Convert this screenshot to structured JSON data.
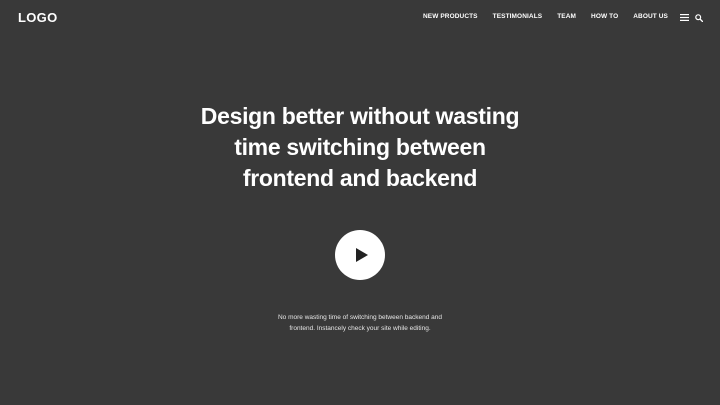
{
  "header": {
    "logo": "LOGO",
    "nav": [
      {
        "label": "NEW PRODUCTS"
      },
      {
        "label": "TESTIMONIALS"
      },
      {
        "label": "TEAM"
      },
      {
        "label": "HOW TO"
      },
      {
        "label": "ABOUT US"
      }
    ],
    "icons": {
      "menu": "hamburger-menu-icon",
      "search": "search-icon"
    }
  },
  "hero": {
    "title_lines": [
      "Design better without wasting",
      "time switching between",
      "frontend and backend"
    ],
    "play_icon": "play-icon",
    "subtitle_lines": [
      "No more wasting time of switching between backend and",
      "frontend. Instancely check your site while editing."
    ]
  },
  "colors": {
    "background": "#393939",
    "text": "#ffffff",
    "play_button": "#ffffff",
    "play_glyph": "#222222"
  }
}
